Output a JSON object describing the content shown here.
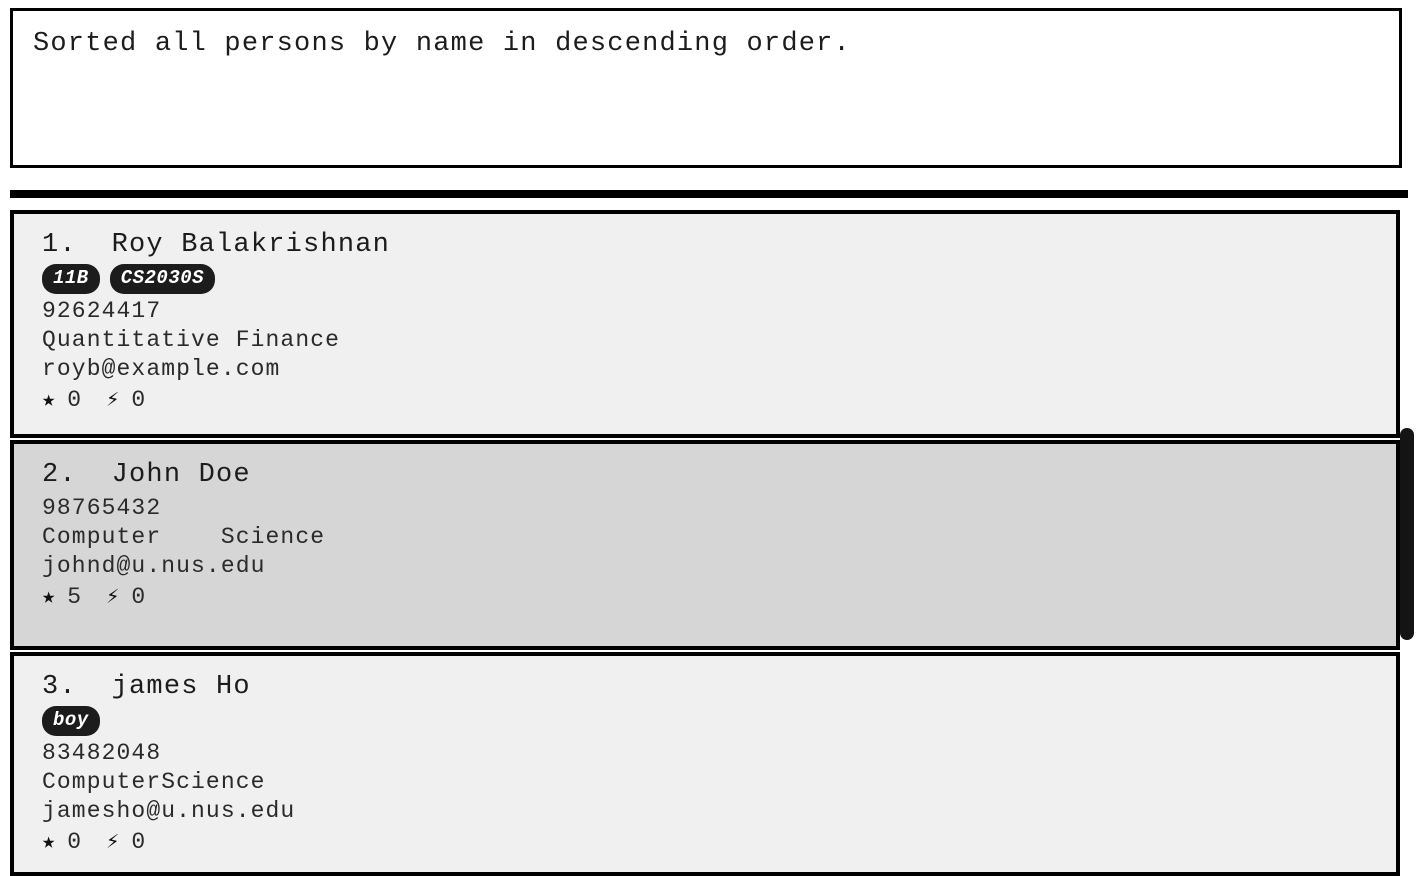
{
  "result": {
    "message": "Sorted all persons by name in descending order."
  },
  "colors": {
    "card_background": "#F0F0F0",
    "card_selected_background": "#D6D6D6",
    "border": "#000000",
    "tag_background": "#1C1C1C",
    "tag_text": "#FFFFFF",
    "scrollbar_thumb": "#141414"
  },
  "icons": {
    "star": "★",
    "bolt": "⚡"
  },
  "list": {
    "items": [
      {
        "index": "1.",
        "name": "Roy Balakrishnan",
        "title": "1.  Roy Balakrishnan",
        "tags": [
          "11B",
          "CS2030S"
        ],
        "phone": "92624417",
        "address": "Quantitative Finance",
        "email": "royb@example.com",
        "star_count": "0",
        "bolt_count": "0",
        "selected": false
      },
      {
        "index": "2.",
        "name": "John Doe",
        "title": "2.  John Doe",
        "tags": [],
        "phone": "98765432",
        "address": "Computer    Science",
        "email": "johnd@u.nus.edu",
        "star_count": "5",
        "bolt_count": "0",
        "selected": true
      },
      {
        "index": "3.",
        "name": "james Ho",
        "title": "3.  james Ho",
        "tags": [
          "boy"
        ],
        "phone": "83482048",
        "address": "ComputerScience",
        "email": "jamesho@u.nus.edu",
        "star_count": "0",
        "bolt_count": "0",
        "selected": false
      }
    ]
  },
  "scrollbar": {
    "position": "top",
    "thumb_visible": true
  }
}
